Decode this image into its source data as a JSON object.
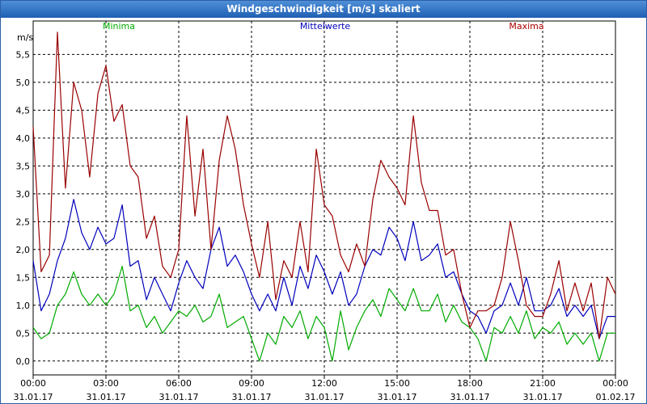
{
  "window": {
    "title": "Windgeschwindigkeit [m/s] skaliert"
  },
  "chart_data": {
    "type": "line",
    "title": "Windgeschwindigkeit [m/s] skaliert",
    "ylabel": "m/s",
    "ylim": [
      -0.25,
      6.1
    ],
    "y_ticks": [
      "0,0",
      "0,5",
      "1,0",
      "1,5",
      "2,0",
      "2,5",
      "3,0",
      "3,5",
      "4,0",
      "4,5",
      "5,0",
      "5,5"
    ],
    "x_ticks": [
      {
        "time": "00:00",
        "date": "31.01.17"
      },
      {
        "time": "03:00",
        "date": "31.01.17"
      },
      {
        "time": "06:00",
        "date": "31.01.17"
      },
      {
        "time": "09:00",
        "date": "31.01.17"
      },
      {
        "time": "12:00",
        "date": "31.01.17"
      },
      {
        "time": "15:00",
        "date": "31.01.17"
      },
      {
        "time": "18:00",
        "date": "31.01.17"
      },
      {
        "time": "21:00",
        "date": "31.01.17"
      },
      {
        "time": "00:00",
        "date": "01.02.17"
      }
    ],
    "x_unit": "hours",
    "grid": true,
    "legend": "top",
    "x_hours": [
      0,
      0.33,
      0.67,
      1,
      1.33,
      1.67,
      2,
      2.33,
      2.67,
      3,
      3.33,
      3.67,
      4,
      4.33,
      4.67,
      5,
      5.33,
      5.67,
      6,
      6.33,
      6.67,
      7,
      7.33,
      7.67,
      8,
      8.33,
      8.67,
      9,
      9.33,
      9.67,
      10,
      10.33,
      10.67,
      11,
      11.33,
      11.67,
      12,
      12.33,
      12.67,
      13,
      13.33,
      13.67,
      14,
      14.33,
      14.67,
      15,
      15.33,
      15.67,
      16,
      16.33,
      16.67,
      17,
      17.33,
      17.67,
      18,
      18.33,
      18.67,
      19,
      19.33,
      19.67,
      20,
      20.33,
      20.67,
      21,
      21.33,
      21.67,
      22,
      22.33,
      22.67,
      23,
      23.33,
      23.67,
      24
    ],
    "series": [
      {
        "name": "Minima",
        "color": "#00aa00",
        "values": [
          0.6,
          0.4,
          0.5,
          1.0,
          1.2,
          1.6,
          1.2,
          1.0,
          1.2,
          1.0,
          1.2,
          1.7,
          0.9,
          1.0,
          0.6,
          0.8,
          0.5,
          0.7,
          0.9,
          0.8,
          1.0,
          0.7,
          0.8,
          1.2,
          0.6,
          0.7,
          0.8,
          0.4,
          0.0,
          0.5,
          0.3,
          0.8,
          0.6,
          0.9,
          0.4,
          0.8,
          0.6,
          0.0,
          0.9,
          0.2,
          0.6,
          0.9,
          1.1,
          0.8,
          1.3,
          1.1,
          0.9,
          1.3,
          0.9,
          0.9,
          1.2,
          0.7,
          1.0,
          0.7,
          0.6,
          0.4,
          0.0,
          0.6,
          0.5,
          0.8,
          0.5,
          0.9,
          0.4,
          0.6,
          0.5,
          0.7,
          0.3,
          0.5,
          0.3,
          0.5,
          0.0,
          0.5,
          0.5
        ],
        "label_color": "#00aa00"
      },
      {
        "name": "Mittelwerte",
        "color": "#0000bb",
        "values": [
          1.8,
          0.9,
          1.2,
          1.8,
          2.2,
          2.9,
          2.3,
          2.0,
          2.4,
          2.1,
          2.2,
          2.8,
          1.7,
          1.8,
          1.1,
          1.5,
          1.2,
          0.9,
          1.4,
          1.8,
          1.5,
          1.3,
          2.0,
          2.4,
          1.7,
          1.9,
          1.6,
          1.2,
          0.9,
          1.2,
          0.9,
          1.5,
          1.0,
          1.7,
          1.3,
          1.9,
          1.6,
          1.2,
          1.6,
          1.0,
          1.2,
          1.7,
          2.0,
          1.9,
          2.4,
          2.2,
          1.8,
          2.5,
          1.8,
          1.9,
          2.1,
          1.5,
          1.6,
          1.2,
          0.9,
          0.8,
          0.5,
          0.9,
          1.0,
          1.4,
          1.0,
          1.5,
          0.9,
          0.9,
          1.0,
          1.3,
          0.8,
          1.0,
          0.8,
          1.0,
          0.4,
          0.8,
          0.8
        ],
        "label_color": "#0000bb"
      },
      {
        "name": "Maxima",
        "color": "#990000",
        "values": [
          4.2,
          1.6,
          1.9,
          5.9,
          3.1,
          5.0,
          4.5,
          3.3,
          4.8,
          5.3,
          4.3,
          4.6,
          3.5,
          3.3,
          2.2,
          2.6,
          1.7,
          1.5,
          2.0,
          4.4,
          2.6,
          3.8,
          2.0,
          3.6,
          4.4,
          3.8,
          2.8,
          2.1,
          1.5,
          2.5,
          1.1,
          1.8,
          1.5,
          2.5,
          1.6,
          3.8,
          2.8,
          2.6,
          1.9,
          1.6,
          2.1,
          1.7,
          2.9,
          3.6,
          3.3,
          3.1,
          2.8,
          4.4,
          3.2,
          2.7,
          2.7,
          1.9,
          2.0,
          1.2,
          0.6,
          0.9,
          0.9,
          1.0,
          1.5,
          2.5,
          1.8,
          1.0,
          0.8,
          0.8,
          1.2,
          1.8,
          0.9,
          1.4,
          0.9,
          1.4,
          0.4,
          1.5,
          1.2
        ],
        "label_color": "#aa0000"
      }
    ]
  }
}
